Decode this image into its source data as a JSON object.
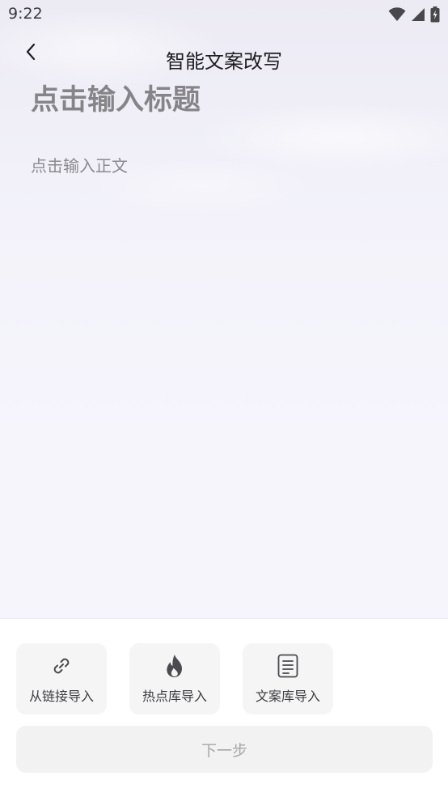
{
  "status_bar": {
    "time": "9:22",
    "icons": [
      "wifi-icon",
      "cellular-signal-icon",
      "battery-charging-icon"
    ]
  },
  "header": {
    "title": "智能文案改写",
    "back_icon": "chevron-left-icon"
  },
  "editor": {
    "title_placeholder": "点击输入标题",
    "body_placeholder": "点击输入正文"
  },
  "import_options": [
    {
      "label": "从链接导入",
      "icon": "link-icon"
    },
    {
      "label": "热点库导入",
      "icon": "flame-icon"
    },
    {
      "label": "文案库导入",
      "icon": "document-icon"
    }
  ],
  "next_button": {
    "label": "下一步",
    "enabled": false
  },
  "colors": {
    "background": "#f5f4fb",
    "panel": "#ffffff",
    "card": "#f5f5f5",
    "disabled_text": "#a7a7aa",
    "placeholder_text": "#858589"
  }
}
